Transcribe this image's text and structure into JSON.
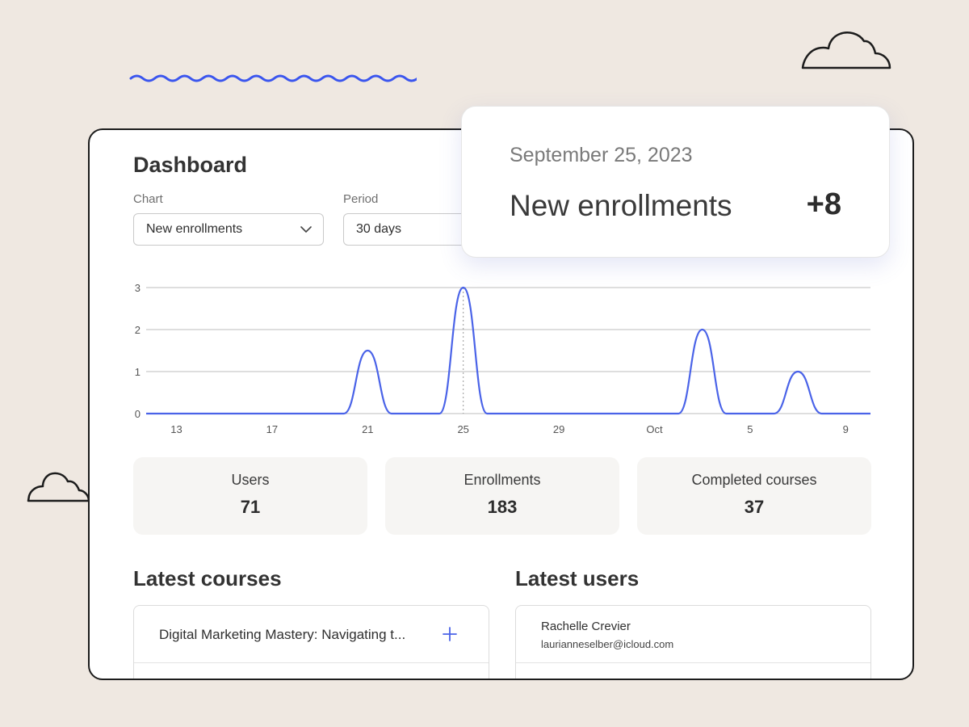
{
  "page": {
    "title": "Dashboard",
    "accent_color": "#4a63e8",
    "background_color": "#efe8e1"
  },
  "filters": {
    "chart_label": "Chart",
    "chart_value": "New enrollments",
    "period_label": "Period",
    "period_value": "30 days"
  },
  "chart_data": {
    "type": "line",
    "x_ticks": [
      "13",
      "17",
      "21",
      "25",
      "29",
      "Oct",
      "5",
      "9"
    ],
    "y_ticks": [
      "0",
      "1",
      "2",
      "3"
    ],
    "ylim": [
      0,
      3
    ],
    "grid": true,
    "color": "#4a63e8",
    "x": [
      "Sep 12",
      "Sep 13",
      "Sep 14",
      "Sep 15",
      "Sep 16",
      "Sep 17",
      "Sep 18",
      "Sep 19",
      "Sep 20",
      "Sep 21",
      "Sep 22",
      "Sep 23",
      "Sep 24",
      "Sep 25",
      "Sep 26",
      "Sep 27",
      "Sep 28",
      "Sep 29",
      "Sep 30",
      "Oct 1",
      "Oct 2",
      "Oct 3",
      "Oct 4",
      "Oct 5",
      "Oct 6",
      "Oct 7",
      "Oct 8",
      "Oct 9",
      "Oct 10"
    ],
    "values": [
      0,
      0,
      0,
      0,
      0,
      0,
      0,
      0,
      0,
      1.5,
      0,
      0,
      0,
      3,
      0,
      0,
      0,
      0,
      0,
      0,
      0,
      0,
      0,
      2,
      0,
      0,
      0,
      1,
      0
    ],
    "highlight": "Sep 25"
  },
  "stats": [
    {
      "label": "Users",
      "value": "71"
    },
    {
      "label": "Enrollments",
      "value": "183"
    },
    {
      "label": "Completed courses",
      "value": "37"
    }
  ],
  "latest_courses": {
    "title": "Latest courses",
    "items": [
      {
        "title": "Digital Marketing Mastery: Navigating t..."
      }
    ]
  },
  "latest_users": {
    "title": "Latest users",
    "items": [
      {
        "name": "Rachelle Crevier",
        "email": "laurianneselber@icloud.com"
      }
    ]
  },
  "tooltip": {
    "date": "September 25, 2023",
    "label": "New enrollments",
    "value": "+8"
  },
  "icons": {
    "select_caret": "chevron-down-icon",
    "add": "plus-icon",
    "decorations": [
      "wave-decoration",
      "cloud-icon"
    ]
  }
}
